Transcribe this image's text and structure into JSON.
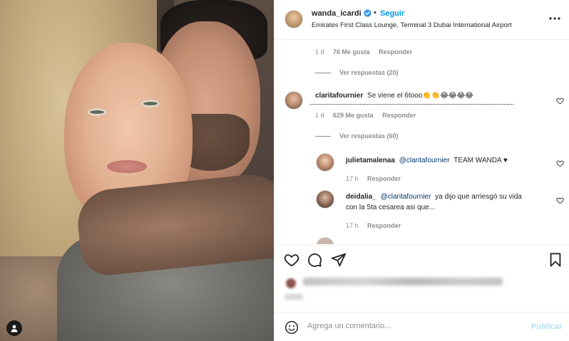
{
  "post": {
    "username": "wanda_icardi",
    "follow_label": "Seguir",
    "separator": "•",
    "location": "Emirates First Class Lounge, Terminal 3 Dubai International Airport"
  },
  "top_meta": {
    "time": "1 d",
    "likes": "76 Me gusta",
    "reply": "Responder"
  },
  "top_replies": "Ver respuestas (20)",
  "comment": {
    "username": "claritafournier",
    "text": "Se viene el 6tooo👏👏😂😂😂😂",
    "time": "1 d",
    "likes": "629 Me gusta",
    "reply": "Responder",
    "replies_label": "Ver respuestas (60)"
  },
  "replies": [
    {
      "username": "julietamalenaa",
      "mention": "@claritafournier",
      "text": "TEAM WANDA ♥",
      "time": "17 h",
      "reply": "Responder"
    },
    {
      "username": "deidalia_",
      "mention": "@claritafournier",
      "text": "ya dijo que arriesgó su vida",
      "text2": "con la 5ta cesarea asi que...",
      "time": "17 h",
      "reply": "Responder"
    }
  ],
  "add_comment": {
    "placeholder": "Agrega un comentario...",
    "publish": "Publicar"
  },
  "colors": {
    "link": "#0095f6",
    "muted": "#8e8e8e",
    "text": "#262626",
    "publish_disabled": "#b2dffc"
  }
}
